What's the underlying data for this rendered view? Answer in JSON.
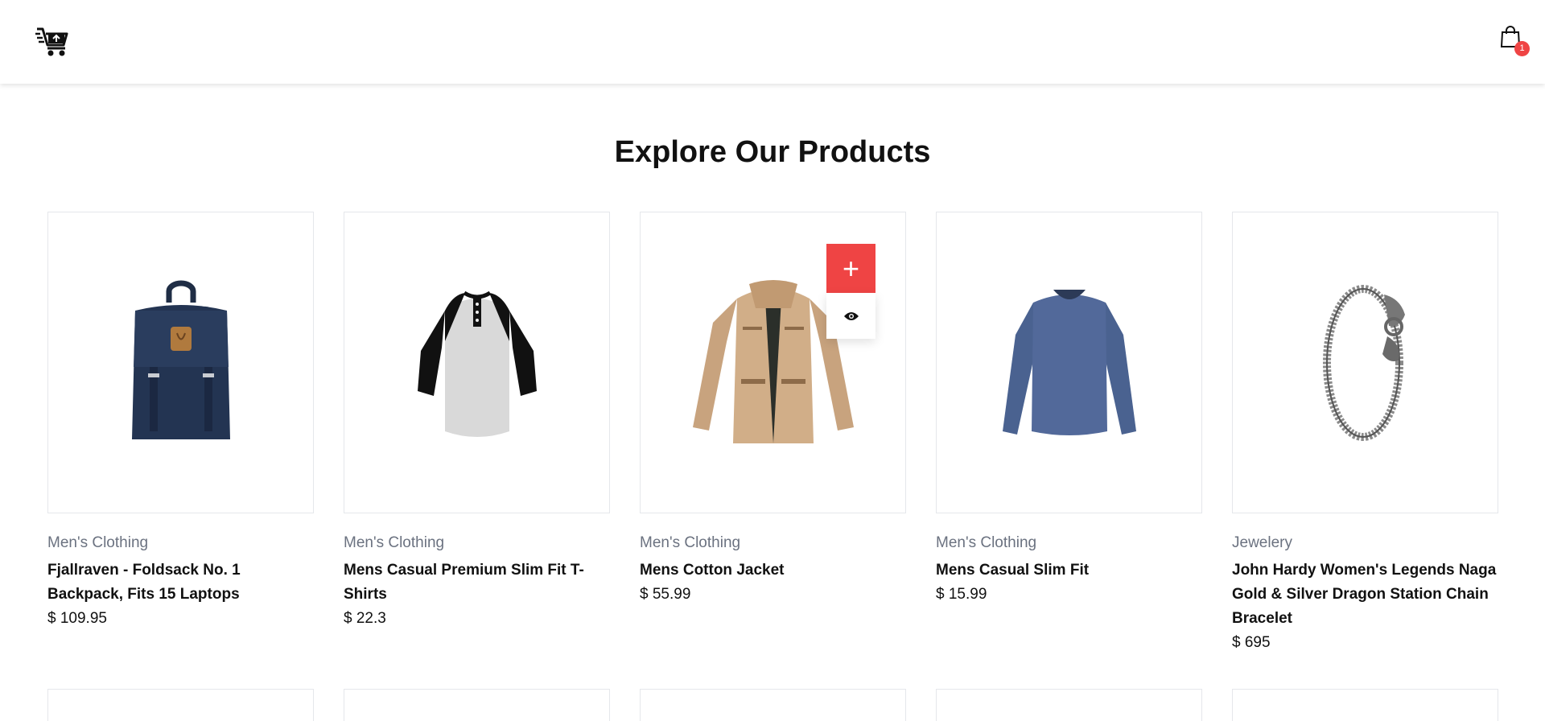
{
  "header": {
    "logo_icon": "cart-logo-icon",
    "bag_icon": "shopping-bag-icon",
    "cart_count": "1"
  },
  "page_title": "Explore Our Products",
  "colors": {
    "accent": "#ef4444",
    "muted_text": "#6b7280",
    "border": "#e5e7eb"
  },
  "products": [
    {
      "category": "Men's Clothing",
      "name": "Fjallraven - Foldsack No. 1 Backpack, Fits 15 Laptops",
      "price": "$ 109.95",
      "image_icon": "backpack-image"
    },
    {
      "category": "Men's Clothing",
      "name": "Mens Casual Premium Slim Fit T-Shirts",
      "price": "$ 22.3",
      "image_icon": "raglan-tshirt-image"
    },
    {
      "category": "Men's Clothing",
      "name": "Mens Cotton Jacket",
      "price": "$ 55.99",
      "image_icon": "jacket-image"
    },
    {
      "category": "Men's Clothing",
      "name": "Mens Casual Slim Fit",
      "price": "$ 15.99",
      "image_icon": "longsleeve-shirt-image"
    },
    {
      "category": "Jewelery",
      "name": "John Hardy Women's Legends Naga Gold & Silver Dragon Station Chain Bracelet",
      "price": "$ 695",
      "image_icon": "bracelet-image"
    }
  ],
  "hover_actions": {
    "add_label": "+",
    "view_icon": "eye-icon"
  }
}
